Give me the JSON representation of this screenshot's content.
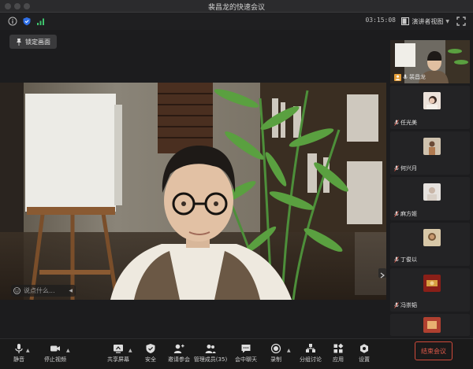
{
  "window": {
    "title": "裴昌龙的快速会议"
  },
  "status": {
    "timer": "03:15:08",
    "view_label": "演讲者视图"
  },
  "lock_button": {
    "label": "锁定画面"
  },
  "chat_hint": {
    "placeholder": "说点什么..."
  },
  "participants": [
    {
      "name": "裴昌龙",
      "host": true
    },
    {
      "name": "任光美"
    },
    {
      "name": "何兴月"
    },
    {
      "name": "麻方姬"
    },
    {
      "name": "丁俊以"
    },
    {
      "name": "冯崇韬"
    }
  ],
  "toolbar": {
    "mute": "静音",
    "stop_video": "停止视频",
    "share": "共享屏幕",
    "security": "安全",
    "invite": "邀请参会",
    "manage": "管理成员(35)",
    "chat": "会中聊天",
    "record": "录制",
    "breakout": "分组讨论",
    "apps": "应用",
    "settings": "设置",
    "end": "结束会议"
  },
  "colors": {
    "end_red": "#e25a4a",
    "host_badge": "#e8a03a",
    "shield_blue": "#2f6fe6",
    "signal_green": "#3ec46d"
  }
}
